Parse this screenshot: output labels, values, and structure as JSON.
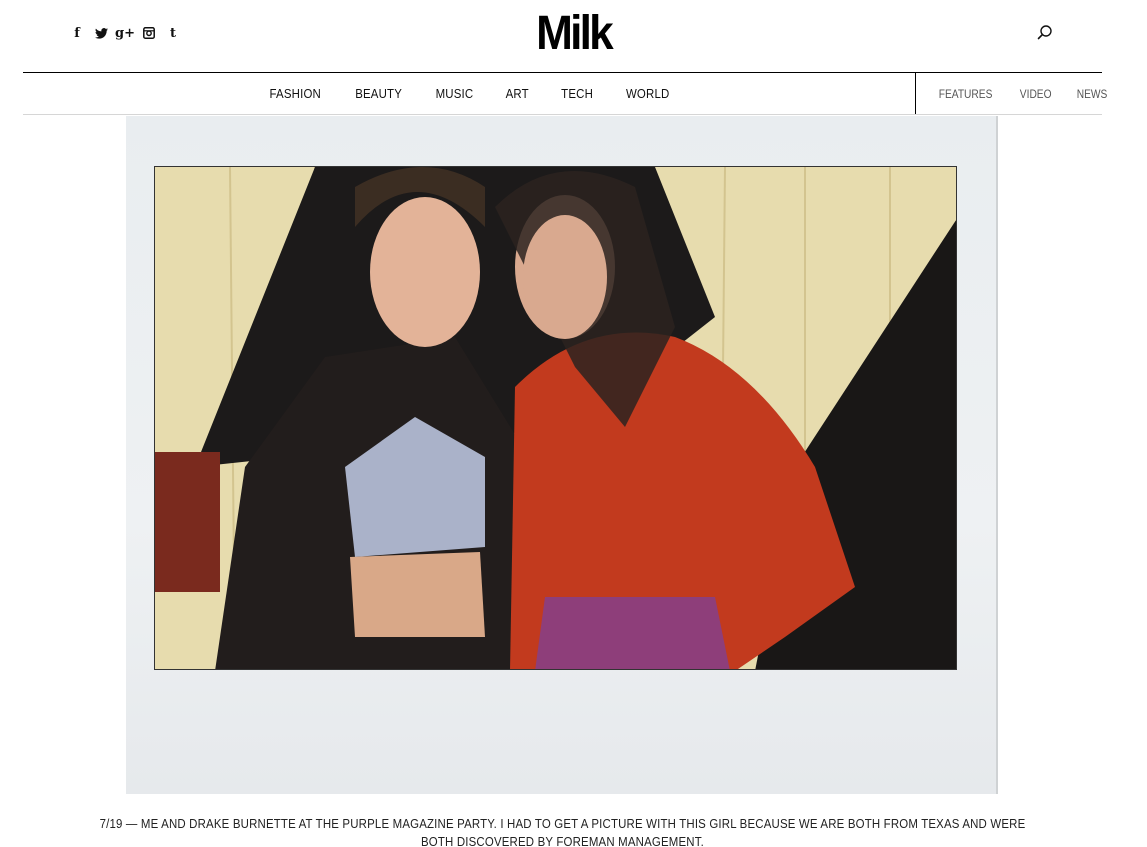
{
  "header": {
    "logo": "Milk",
    "social": [
      {
        "name": "facebook-icon",
        "glyph": "f"
      },
      {
        "name": "twitter-icon",
        "glyph": "❧"
      },
      {
        "name": "google-plus-icon",
        "glyph": "g+"
      },
      {
        "name": "instagram-icon",
        "glyph": "▣"
      },
      {
        "name": "tumblr-icon",
        "glyph": "t"
      }
    ]
  },
  "nav": {
    "main": [
      "FASHION",
      "BEAUTY",
      "MUSIC",
      "ART",
      "TECH",
      "WORLD"
    ],
    "side": [
      "FEATURES",
      "VIDEO",
      "NEWS"
    ]
  },
  "caption": "7/19 — ME AND DRAKE BURNETTE AT THE PURPLE MAGAZINE PARTY. I HAD TO GET A PICTURE WITH THIS GIRL BECAUSE WE ARE BOTH FROM TEXAS AND WERE BOTH DISCOVERED BY FOREMAN MANAGEMENT.",
  "colors": {
    "accent": "#000000",
    "cardigan": "#c23a1e",
    "wall": "#e7dcae"
  }
}
